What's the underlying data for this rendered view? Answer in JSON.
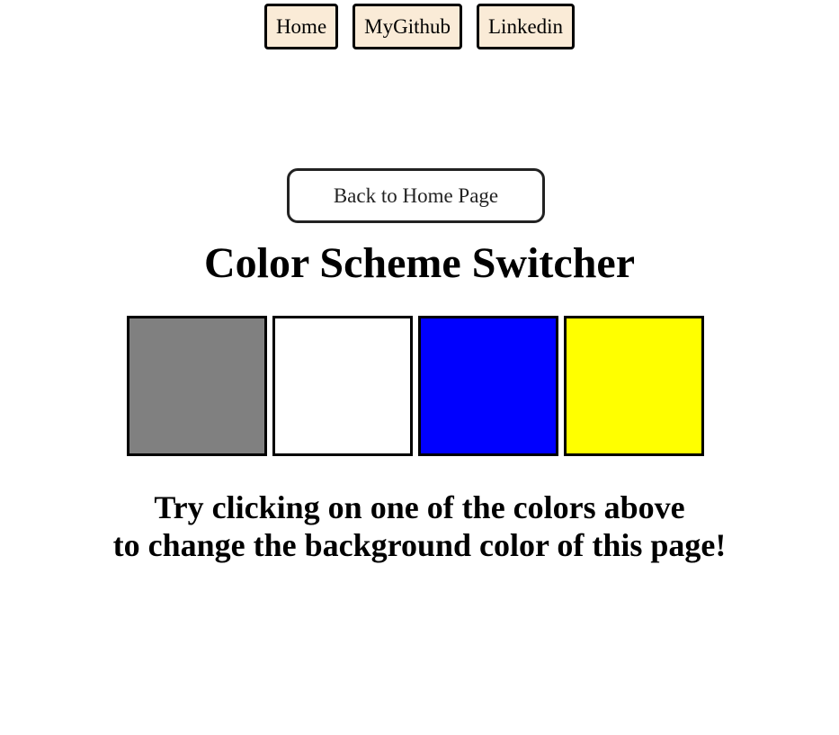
{
  "nav": {
    "links": [
      {
        "label": "Home"
      },
      {
        "label": "MyGithub"
      },
      {
        "label": "Linkedin"
      }
    ]
  },
  "back_button": {
    "label": "Back to Home Page"
  },
  "page_title": "Color Scheme Switcher",
  "swatches": [
    {
      "color": "#808080"
    },
    {
      "color": "#ffffff"
    },
    {
      "color": "#0000ff"
    },
    {
      "color": "#ffff00"
    }
  ],
  "instructions": {
    "line1": "Try clicking on one of the colors above",
    "line2": "to change the background color of this page!"
  }
}
